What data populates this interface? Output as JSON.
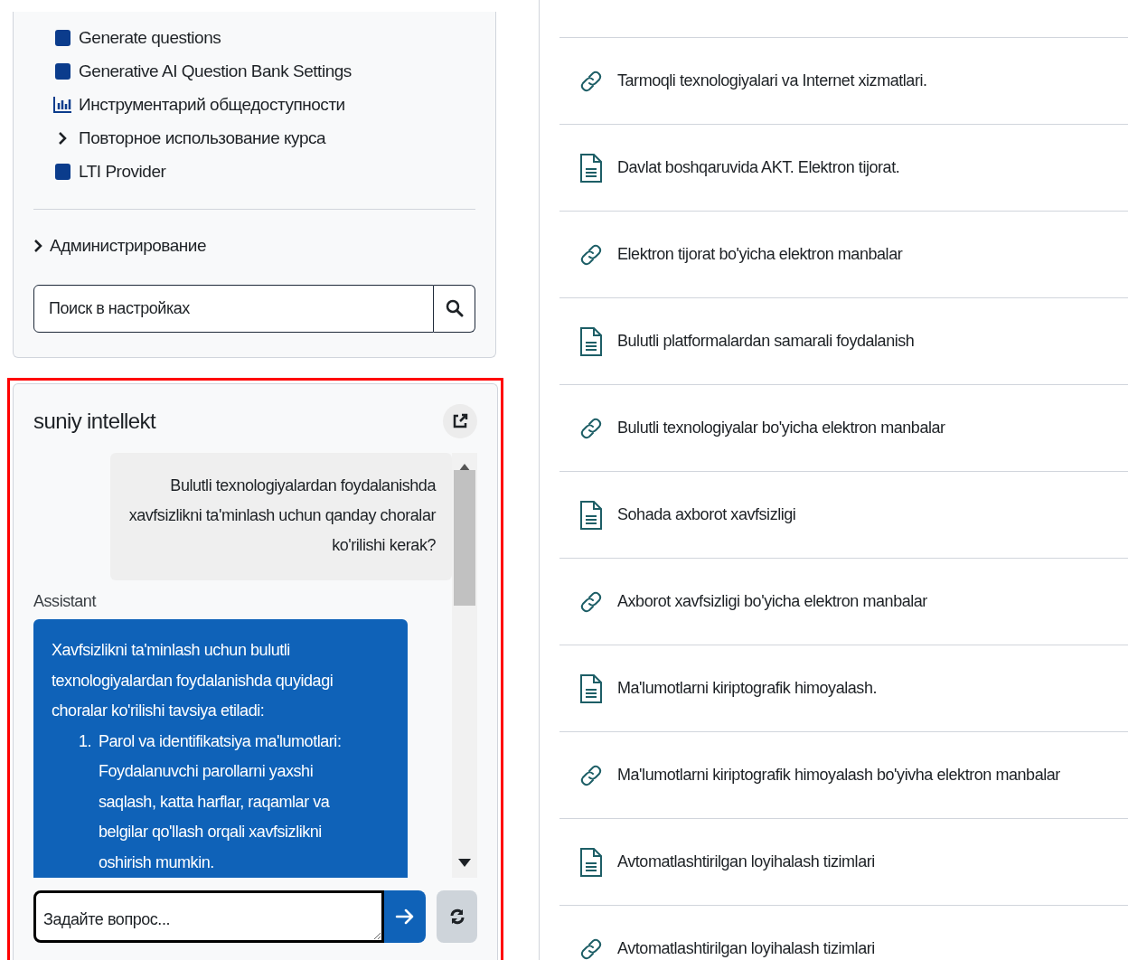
{
  "settings_menu": {
    "items": [
      {
        "kind": "square",
        "label": "Generate questions"
      },
      {
        "kind": "square",
        "label": "Generative AI Question Bank Settings"
      },
      {
        "kind": "chart",
        "label": "Инструментарий общедоступности"
      },
      {
        "kind": "chevron",
        "label": "Повторное использование курса"
      },
      {
        "kind": "square",
        "label": "LTI Provider"
      }
    ],
    "section": {
      "label": "Администрирование"
    },
    "search": {
      "placeholder": "Поиск в настройках"
    }
  },
  "chat": {
    "title": "suniy intellekt",
    "user_message": "Bulutli texnologiyalardan foydalanishda xavfsizlikni ta'minlash uchun qanday choralar ko'rilishi kerak?",
    "assistant_label": "Assistant",
    "assistant_message": {
      "intro": "Xavfsizlikni ta'minlash uchun bulutli texnologiyalardan foydalanishda quyidagi choralar ko'rilishi tavsiya etiladi:",
      "items": [
        {
          "number": "1.",
          "text": "Parol va identifikatsiya ma'lumotlari: Foydalanuvchi parollarni yaxshi saqlash, katta harflar, raqamlar va belgilar qo'llash orqali xavfsizlikni oshirish mumkin."
        }
      ]
    },
    "input": {
      "placeholder": "Задайте вопрос..."
    }
  },
  "resources": [
    {
      "kind": "link",
      "title": "Tarmoqli texnologiyalari va Internet xizmatlari."
    },
    {
      "kind": "file",
      "title": "Davlat boshqaruvida AKT. Elektron tijorat."
    },
    {
      "kind": "link",
      "title": "Elektron tijorat bo'yicha elektron manbalar"
    },
    {
      "kind": "file",
      "title": "Bulutli platformalardan samarali foydalanish"
    },
    {
      "kind": "link",
      "title": "Bulutli texnologiyalar bo'yicha elektron manbalar"
    },
    {
      "kind": "file",
      "title": "Sohada axborot xavfsizligi"
    },
    {
      "kind": "link",
      "title": "Axborot xavfsizligi bo'yicha elektron manbalar"
    },
    {
      "kind": "file",
      "title": "Ma'lumotlarni kiriptografik himoyalash."
    },
    {
      "kind": "link",
      "title": "Ma'lumotlarni kiriptografik himoyalash bo'yivha elektron manbalar"
    },
    {
      "kind": "file",
      "title": "Avtomatlashtirilgan loyihalash tizimlari"
    },
    {
      "kind": "link",
      "title": "Avtomatlashtirilgan loyihalash tizimlari"
    }
  ]
}
